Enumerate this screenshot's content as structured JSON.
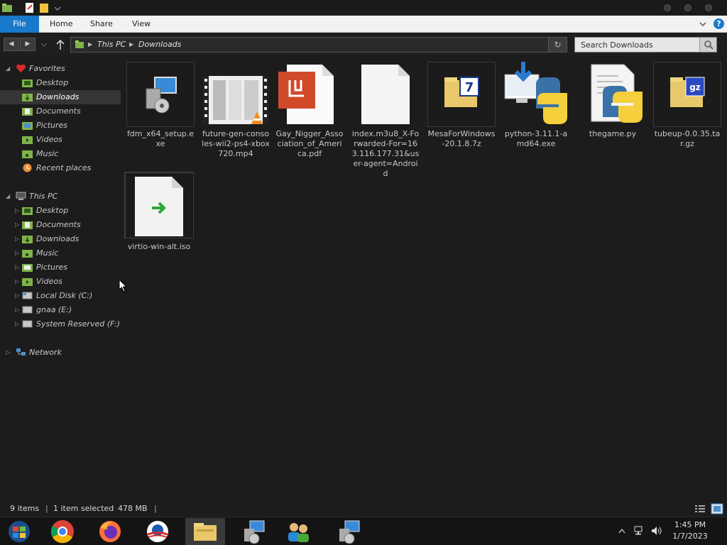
{
  "ribbon": {
    "file": "File",
    "home": "Home",
    "share": "Share",
    "view": "View",
    "help": "?"
  },
  "address": {
    "root": "This PC",
    "folder": "Downloads"
  },
  "search": {
    "placeholder": "Search Downloads"
  },
  "sidebar": {
    "favorites": "Favorites",
    "fav_items": [
      "Desktop",
      "Downloads",
      "Documents",
      "Pictures",
      "Videos",
      "Music",
      "Recent places"
    ],
    "thispc": "This PC",
    "pc_items": [
      "Desktop",
      "Documents",
      "Downloads",
      "Music",
      "Pictures",
      "Videos",
      "Local Disk (C:)",
      "gnaa (E:)",
      "System Reserved (F:)"
    ],
    "network": "Network"
  },
  "files": [
    "fdm_x64_setup.exe",
    "future-gen-consoles-wii2-ps4-xbox720.mp4",
    "Gay_Nigger_Association_of_America.pdf",
    "index.m3u8_X-Forwarded-For=163.116.177.31&user-agent=Android",
    "MesaForWindows-20.1.8.7z",
    "python-3.11.1-amd64.exe",
    "thegame.py",
    "tubeup-0.0.35.tar.gz",
    "virtio-win-alt.iso"
  ],
  "status": {
    "count": "9 items",
    "selected": "1 item selected",
    "size": "478 MB"
  },
  "clock": {
    "time": "1:45 PM",
    "date": "1/7/2023"
  },
  "colors": {
    "accent": "#1979ca",
    "folder": "#e8c86a",
    "python_blue": "#3a72a8",
    "python_yellow": "#f5cf3c"
  }
}
